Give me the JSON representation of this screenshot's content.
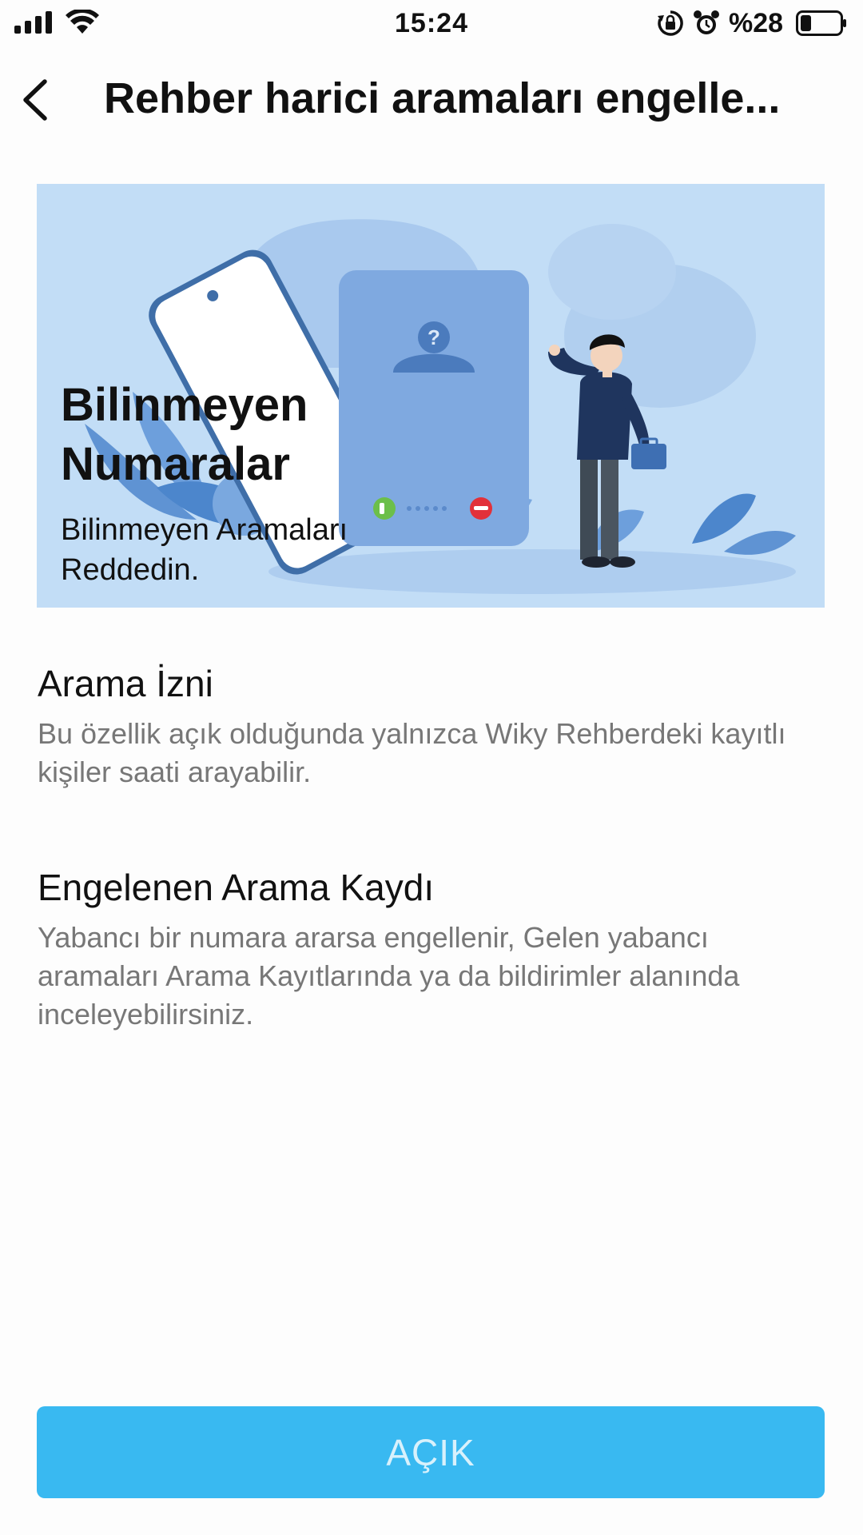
{
  "status_bar": {
    "time": "15:24",
    "battery_text": "%28",
    "icons": [
      "cellular-signal-icon",
      "wifi-icon",
      "rotation-lock-icon",
      "alarm-icon",
      "battery-icon"
    ]
  },
  "header": {
    "back_icon": "chevron-left-icon",
    "title": "Rehber harici aramaları engelle..."
  },
  "banner": {
    "title": "Bilinmeyen\nNumaralar",
    "subtitle": "Bilinmeyen Aramaları\nReddedin.",
    "colors": {
      "background": "#c2ddf6",
      "accept": "#6cbf4a",
      "decline": "#e2313a"
    }
  },
  "sections": [
    {
      "title": "Arama İzni",
      "description": "Bu özellik açık olduğunda yalnızca Wiky Rehberdeki kayıtlı kişiler saati arayabilir."
    },
    {
      "title": "Engelenen Arama Kaydı",
      "description": "Yabancı bir numara ararsa engellenir, Gelen yabancı aramaları Arama Kayıtlarında ya da bildirimler alanında inceleyebilirsiniz."
    }
  ],
  "button": {
    "label": "AÇIK",
    "color": "#39b9f1"
  }
}
